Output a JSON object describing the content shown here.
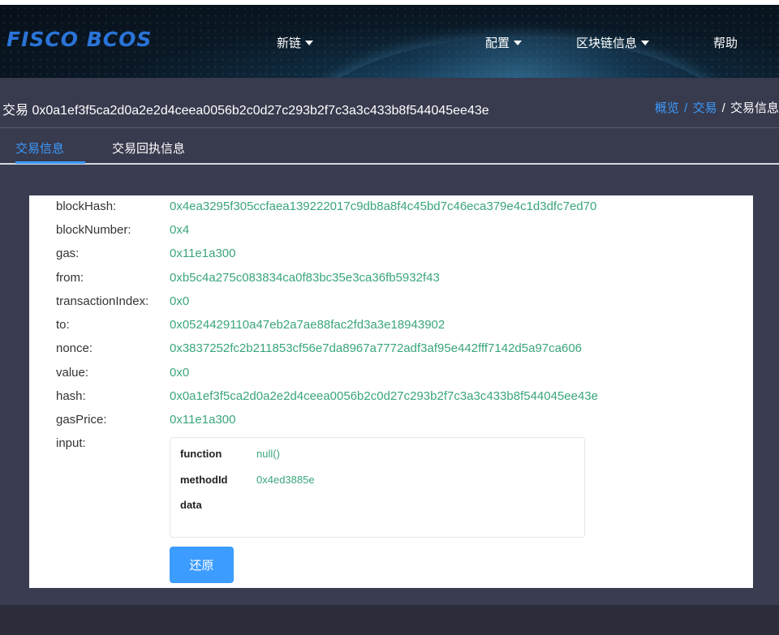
{
  "header": {
    "logo": "FISCO BCOS",
    "nav": [
      {
        "label": "新链",
        "has_dropdown": true
      },
      {
        "label": "配置",
        "has_dropdown": true
      },
      {
        "label": "区块链信息",
        "has_dropdown": true
      },
      {
        "label": "帮助",
        "has_dropdown": false
      }
    ]
  },
  "titlebar": {
    "title": "交易 0x0a1ef3f5ca2d0a2e2d4ceea0056b2c0d27c293b2f7c3a3c433b8f544045ee43e",
    "breadcrumb": {
      "overview": "概览",
      "sep1": "/",
      "transaction": "交易",
      "sep2": "/",
      "current": "交易信息"
    }
  },
  "tabs": [
    {
      "label": "交易信息",
      "active": true
    },
    {
      "label": "交易回执信息",
      "active": false
    }
  ],
  "transaction": [
    {
      "key": "blockHash:",
      "value": "0x4ea3295f305ccfaea139222017c9db8a8f4c45bd7c46eca379e4c1d3dfc7ed70"
    },
    {
      "key": "blockNumber:",
      "value": "0x4"
    },
    {
      "key": "gas:",
      "value": "0x11e1a300"
    },
    {
      "key": "from:",
      "value": "0xb5c4a275c083834ca0f83bc35e3ca36fb5932f43"
    },
    {
      "key": "transactionIndex:",
      "value": "0x0"
    },
    {
      "key": "to:",
      "value": "0x0524429110a47eb2a7ae88fac2fd3a3e18943902"
    },
    {
      "key": "nonce:",
      "value": "0x3837252fc2b211853cf56e7da8967a7772adf3af95e442fff7142d5a97ca606"
    },
    {
      "key": "value:",
      "value": "0x0"
    },
    {
      "key": "hash:",
      "value": "0x0a1ef3f5ca2d0a2e2d4ceea0056b2c0d27c293b2f7c3a3c433b8f544045ee43e"
    },
    {
      "key": "gasPrice:",
      "value": "0x11e1a300"
    }
  ],
  "input": {
    "label": "input:",
    "function_label": "function",
    "function_value": "null()",
    "methodid_label": "methodId",
    "methodid_value": "0x4ed3885e",
    "data_label": "data",
    "data_value": ""
  },
  "restore_button": "还原",
  "colors": {
    "accent": "#3c9cff",
    "value_green": "#3aa67a",
    "panel_bg": "#383a4e",
    "page_bg": "#2b2d3a"
  }
}
